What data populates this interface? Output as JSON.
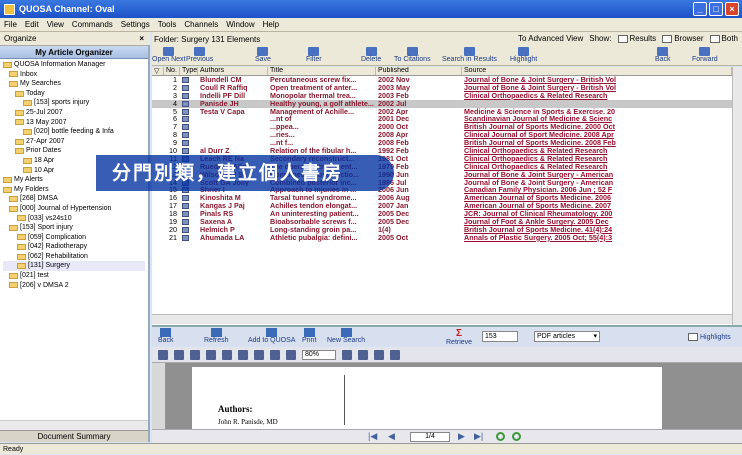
{
  "window": {
    "title": "QUOSA Channel: Oval"
  },
  "menu": [
    "File",
    "Edit",
    "View",
    "Commands",
    "Settings",
    "Tools",
    "Channels",
    "Window",
    "Help"
  ],
  "organize_label": "Organize",
  "left": {
    "header": "My Article Organizer",
    "tree": [
      "QUOSA Information Manager",
      "Inbox",
      "My Searches",
      "Today",
      "[153] sports injury",
      "25-Jul 2007",
      "13 May 2007",
      "[020] bottle feeding & Infa",
      "27-Apr 2007",
      "Prior Dates",
      "18 Apr",
      "10 Apr",
      "My Alerts",
      "My Folders",
      "[268] DMSA",
      "[000] Journal of Hypertension",
      "[033] vs24s10",
      "[153] Sport injury",
      "[059] Complication",
      "[042] Radiotherapy",
      "[062] Rehabilitation",
      "[131] Surgery",
      "[021] test",
      "[206] v DMSA 2"
    ],
    "footer": "Document Summary"
  },
  "folderbar": {
    "name": "Folder: Surgery  131 Elements",
    "adv_view": "To Advanced View",
    "show": "Show:",
    "results": "Results",
    "browser": "Browser",
    "both": "Both"
  },
  "toolbar": {
    "open_next": "Open Next",
    "previous": "Previous",
    "save": "Save",
    "filter": "Filter",
    "delete": "Delete",
    "to_citations": "To Citations",
    "search_in_results": "Search in Results",
    "highlight": "Highlight",
    "back": "Back",
    "forward": "Forward"
  },
  "grid": {
    "headers": [
      "No.",
      "Type",
      "Authors",
      "Title",
      "Published",
      "Source"
    ],
    "rows": [
      {
        "no": "1",
        "author": "Blundell CM",
        "title": "Percutaneous screw fix...",
        "pub": "2002 Nov",
        "src": "Journal of Bone & Joint Surgery - British Vol"
      },
      {
        "no": "2",
        "author": "Coull R Raffiq",
        "title": "Open treatment of anter...",
        "pub": "2003 May",
        "src": "Journal of Bone & Joint Surgery - British Vol"
      },
      {
        "no": "3",
        "author": "Indelli PF Dill",
        "title": "Monopolar thermal trea...",
        "pub": "2003 Feb",
        "src": "Clinical Orthopaedics & Related Research"
      },
      {
        "no": "4",
        "author": "Panisde JH",
        "title": "Healthy young, a golf athlete...",
        "pub": "2002 Jul",
        "src": "",
        "hl": true
      },
      {
        "no": "5",
        "author": "Testa V Capa",
        "title": "Management of Achille...",
        "pub": "2002 Apr",
        "src": "Medicine & Science in Sports & Exercise. 20"
      },
      {
        "no": "6",
        "author": "",
        "title": "...nt of",
        "pub": "2001 Dec",
        "src": "Scandinavian Journal of Medicine & Scienc"
      },
      {
        "no": "7",
        "author": "",
        "title": "...ppea...",
        "pub": "2000 Oct",
        "src": "British Journal of Sports Medicine. 2000 Oct"
      },
      {
        "no": "8",
        "author": "",
        "title": "...ries...",
        "pub": "2008 Apr",
        "src": "Clinical Journal of Sport Medicine. 2008 Apr"
      },
      {
        "no": "9",
        "author": "",
        "title": "...nt f...",
        "pub": "2008 Feb",
        "src": "British Journal of Sports Medicine. 2008 Feb"
      },
      {
        "no": "10",
        "author": "al Durr Z",
        "title": "Relation of the fibular h...",
        "pub": "1992 Feb",
        "src": "Clinical Orthopaedics & Related Research"
      },
      {
        "no": "11",
        "author": "Leach RE Na",
        "title": "Secondary reconstruct...",
        "pub": "1981 Oct",
        "src": "Clinical Orthopaedics & Related Research"
      },
      {
        "no": "12",
        "author": "Ruedi TP Allg",
        "title": "The operative treatment...",
        "pub": "1979 Feb",
        "src": "Clinical Orthopaedics & Related Research"
      },
      {
        "no": "13",
        "author": "Wilson WJ Sc",
        "title": "Combined reconstructio...",
        "pub": "1990 Jun",
        "src": "Journal of Bone & Joint Surgery - American"
      },
      {
        "no": "14",
        "author": "Scott GA Jolly",
        "title": "Combined posterior inc...",
        "pub": "1986 Jul",
        "src": "Journal of Bone & Joint Surgery - American"
      },
      {
        "no": "15",
        "author": "Shrier I",
        "title": "Approach to injuries in ...",
        "pub": "2006 Jun",
        "src": "Canadian Family Physician. 2006 Jun ; 52 F"
      },
      {
        "no": "16",
        "author": "Kinoshita M",
        "title": "Tarsal tunnel syndrome...",
        "pub": "2006 Aug",
        "src": "American Journal of Sports Medicine. 2006"
      },
      {
        "no": "17",
        "author": "Kangas J Paj",
        "title": "Achilles tendon elongat...",
        "pub": "2007 Jan",
        "src": "American Journal of Sports Medicine. 2007"
      },
      {
        "no": "18",
        "author": "Pinals RS",
        "title": "An uninteresting patient...",
        "pub": "2005 Dec",
        "src": "JCR: Journal of Clinical Rheumatology. 200"
      },
      {
        "no": "19",
        "author": "Saxena A",
        "title": "Bioabsorbable screws f...",
        "pub": "2005 Dec",
        "src": "Journal of Foot & Ankle Surgery. 2005 Dec"
      },
      {
        "no": "20",
        "author": "Helmich P",
        "title": "Long-standing groin pa...",
        "pub": "1(4)",
        "src": "British Journal of Sports Medicine. 41(4):24"
      },
      {
        "no": "21",
        "author": "Ahumada LA",
        "title": "Athletic pubalgia: defini...",
        "pub": "2005 Oct",
        "src": "Annals of Plastic Surgery. 2005 Oct; 55(4):3"
      }
    ]
  },
  "banner": "分門別類，建立個人書房",
  "toolbar2": {
    "back": "Back",
    "refresh": "Refresh",
    "add_to_quosa": "Add to QUOSA",
    "print": "Print",
    "new_search": "New Search",
    "retrieve": "Retrieve",
    "count": "153",
    "dropdown": "PDF articles",
    "highlights": "Highlights"
  },
  "pdf": {
    "zoom": "80%",
    "authors": "Authors:",
    "name": "John R. Panisde, MD",
    "page": "1/4"
  },
  "status": "Ready"
}
